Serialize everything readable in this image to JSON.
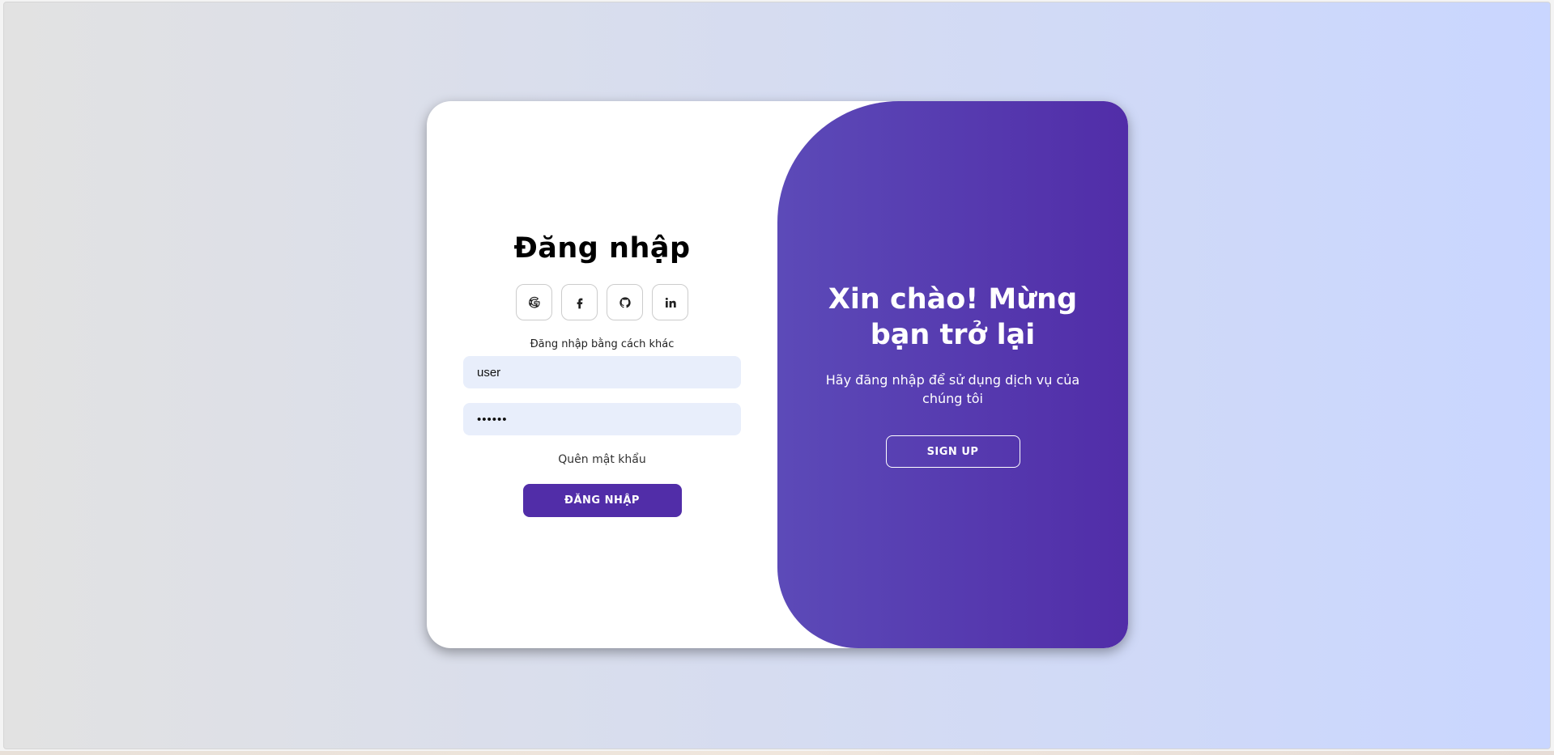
{
  "login": {
    "title": "Đăng nhập",
    "social_icons": [
      "google-icon",
      "facebook-icon",
      "github-icon",
      "linkedin-icon"
    ],
    "alt_text": "Đăng nhập bằng cách khác",
    "username_value": "user",
    "password_value": "••••••",
    "forgot_label": "Quên mật khẩu",
    "submit_label": "ĐĂNG NHẬP"
  },
  "welcome": {
    "title": "Xin chào! Mừng bạn trở lại",
    "text": "Hãy đăng nhập để sử dụng dịch vụ của chúng tôi",
    "signup_label": "SIGN UP"
  },
  "colors": {
    "accent": "#512da8",
    "panel_start": "#5c4ab8",
    "input_bg": "#e8eefb",
    "page_gradient_start": "#e2e2e2",
    "page_gradient_end": "#c9d6ff"
  }
}
